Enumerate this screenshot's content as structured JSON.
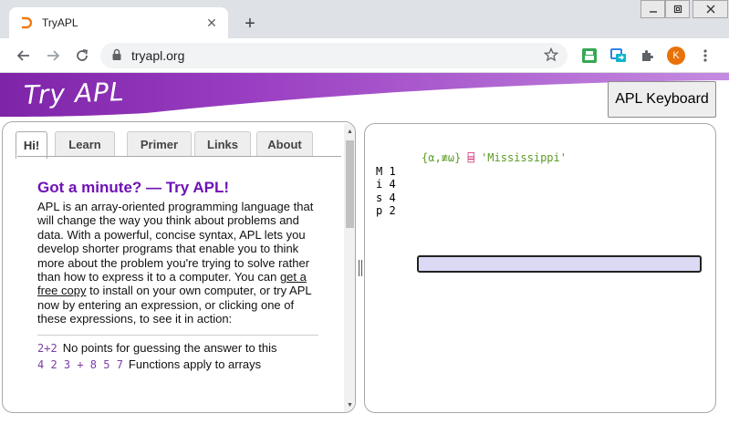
{
  "browser": {
    "tab_title": "TryAPL",
    "url": "tryapl.org",
    "avatar_letter": "K",
    "favicon_color": "#f07a12"
  },
  "page": {
    "logo_text": "Try APL",
    "keyboard_button": "APL Keyboard",
    "banner_color": "#8e2fb3"
  },
  "left_panel": {
    "tabs": [
      {
        "label": "Hi!"
      },
      {
        "label": "Learn"
      },
      {
        "label": "Primer"
      },
      {
        "label": "Links"
      },
      {
        "label": "About"
      }
    ],
    "active_tab": "Hi!",
    "heading": "Got a minute? — Try APL!",
    "intro_part1": "APL is an array-oriented programming language that will change the way you think about problems and data. With a powerful, concise syntax, APL lets you develop shorter programs that enable you to think more about the problem you're trying to solve rather than how to express it to a computer. You can ",
    "intro_link": "get a free copy",
    "intro_part2": " to install on your own computer, or try APL now by entering an expression, or clicking one of these expressions, to see it in action:",
    "examples": [
      {
        "code": "2+2",
        "description": "No points for guessing the answer to this"
      },
      {
        "code": "4 2 3 + 8 5 7",
        "description": "Functions apply to arrays"
      }
    ]
  },
  "session": {
    "input_fn": "{⍺,≢⍵}",
    "input_op": "⌸",
    "input_arg": "'Mississippi'",
    "output_rows": [
      "M 1",
      "i 4",
      "s 4",
      "p 2"
    ],
    "input_value": ""
  }
}
